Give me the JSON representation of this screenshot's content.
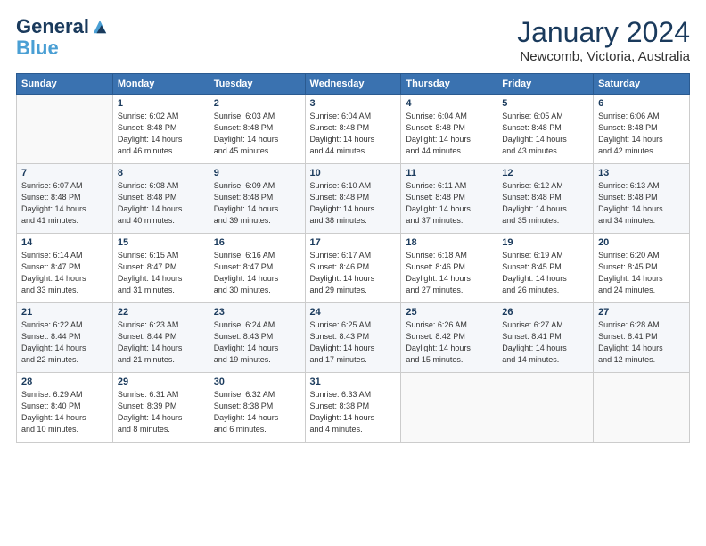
{
  "logo": {
    "line1": "General",
    "line2": "Blue"
  },
  "title": "January 2024",
  "subtitle": "Newcomb, Victoria, Australia",
  "header_days": [
    "Sunday",
    "Monday",
    "Tuesday",
    "Wednesday",
    "Thursday",
    "Friday",
    "Saturday"
  ],
  "weeks": [
    [
      {
        "day": "",
        "info": ""
      },
      {
        "day": "1",
        "info": "Sunrise: 6:02 AM\nSunset: 8:48 PM\nDaylight: 14 hours\nand 46 minutes."
      },
      {
        "day": "2",
        "info": "Sunrise: 6:03 AM\nSunset: 8:48 PM\nDaylight: 14 hours\nand 45 minutes."
      },
      {
        "day": "3",
        "info": "Sunrise: 6:04 AM\nSunset: 8:48 PM\nDaylight: 14 hours\nand 44 minutes."
      },
      {
        "day": "4",
        "info": "Sunrise: 6:04 AM\nSunset: 8:48 PM\nDaylight: 14 hours\nand 44 minutes."
      },
      {
        "day": "5",
        "info": "Sunrise: 6:05 AM\nSunset: 8:48 PM\nDaylight: 14 hours\nand 43 minutes."
      },
      {
        "day": "6",
        "info": "Sunrise: 6:06 AM\nSunset: 8:48 PM\nDaylight: 14 hours\nand 42 minutes."
      }
    ],
    [
      {
        "day": "7",
        "info": "Sunrise: 6:07 AM\nSunset: 8:48 PM\nDaylight: 14 hours\nand 41 minutes."
      },
      {
        "day": "8",
        "info": "Sunrise: 6:08 AM\nSunset: 8:48 PM\nDaylight: 14 hours\nand 40 minutes."
      },
      {
        "day": "9",
        "info": "Sunrise: 6:09 AM\nSunset: 8:48 PM\nDaylight: 14 hours\nand 39 minutes."
      },
      {
        "day": "10",
        "info": "Sunrise: 6:10 AM\nSunset: 8:48 PM\nDaylight: 14 hours\nand 38 minutes."
      },
      {
        "day": "11",
        "info": "Sunrise: 6:11 AM\nSunset: 8:48 PM\nDaylight: 14 hours\nand 37 minutes."
      },
      {
        "day": "12",
        "info": "Sunrise: 6:12 AM\nSunset: 8:48 PM\nDaylight: 14 hours\nand 35 minutes."
      },
      {
        "day": "13",
        "info": "Sunrise: 6:13 AM\nSunset: 8:48 PM\nDaylight: 14 hours\nand 34 minutes."
      }
    ],
    [
      {
        "day": "14",
        "info": "Sunrise: 6:14 AM\nSunset: 8:47 PM\nDaylight: 14 hours\nand 33 minutes."
      },
      {
        "day": "15",
        "info": "Sunrise: 6:15 AM\nSunset: 8:47 PM\nDaylight: 14 hours\nand 31 minutes."
      },
      {
        "day": "16",
        "info": "Sunrise: 6:16 AM\nSunset: 8:47 PM\nDaylight: 14 hours\nand 30 minutes."
      },
      {
        "day": "17",
        "info": "Sunrise: 6:17 AM\nSunset: 8:46 PM\nDaylight: 14 hours\nand 29 minutes."
      },
      {
        "day": "18",
        "info": "Sunrise: 6:18 AM\nSunset: 8:46 PM\nDaylight: 14 hours\nand 27 minutes."
      },
      {
        "day": "19",
        "info": "Sunrise: 6:19 AM\nSunset: 8:45 PM\nDaylight: 14 hours\nand 26 minutes."
      },
      {
        "day": "20",
        "info": "Sunrise: 6:20 AM\nSunset: 8:45 PM\nDaylight: 14 hours\nand 24 minutes."
      }
    ],
    [
      {
        "day": "21",
        "info": "Sunrise: 6:22 AM\nSunset: 8:44 PM\nDaylight: 14 hours\nand 22 minutes."
      },
      {
        "day": "22",
        "info": "Sunrise: 6:23 AM\nSunset: 8:44 PM\nDaylight: 14 hours\nand 21 minutes."
      },
      {
        "day": "23",
        "info": "Sunrise: 6:24 AM\nSunset: 8:43 PM\nDaylight: 14 hours\nand 19 minutes."
      },
      {
        "day": "24",
        "info": "Sunrise: 6:25 AM\nSunset: 8:43 PM\nDaylight: 14 hours\nand 17 minutes."
      },
      {
        "day": "25",
        "info": "Sunrise: 6:26 AM\nSunset: 8:42 PM\nDaylight: 14 hours\nand 15 minutes."
      },
      {
        "day": "26",
        "info": "Sunrise: 6:27 AM\nSunset: 8:41 PM\nDaylight: 14 hours\nand 14 minutes."
      },
      {
        "day": "27",
        "info": "Sunrise: 6:28 AM\nSunset: 8:41 PM\nDaylight: 14 hours\nand 12 minutes."
      }
    ],
    [
      {
        "day": "28",
        "info": "Sunrise: 6:29 AM\nSunset: 8:40 PM\nDaylight: 14 hours\nand 10 minutes."
      },
      {
        "day": "29",
        "info": "Sunrise: 6:31 AM\nSunset: 8:39 PM\nDaylight: 14 hours\nand 8 minutes."
      },
      {
        "day": "30",
        "info": "Sunrise: 6:32 AM\nSunset: 8:38 PM\nDaylight: 14 hours\nand 6 minutes."
      },
      {
        "day": "31",
        "info": "Sunrise: 6:33 AM\nSunset: 8:38 PM\nDaylight: 14 hours\nand 4 minutes."
      },
      {
        "day": "",
        "info": ""
      },
      {
        "day": "",
        "info": ""
      },
      {
        "day": "",
        "info": ""
      }
    ]
  ]
}
